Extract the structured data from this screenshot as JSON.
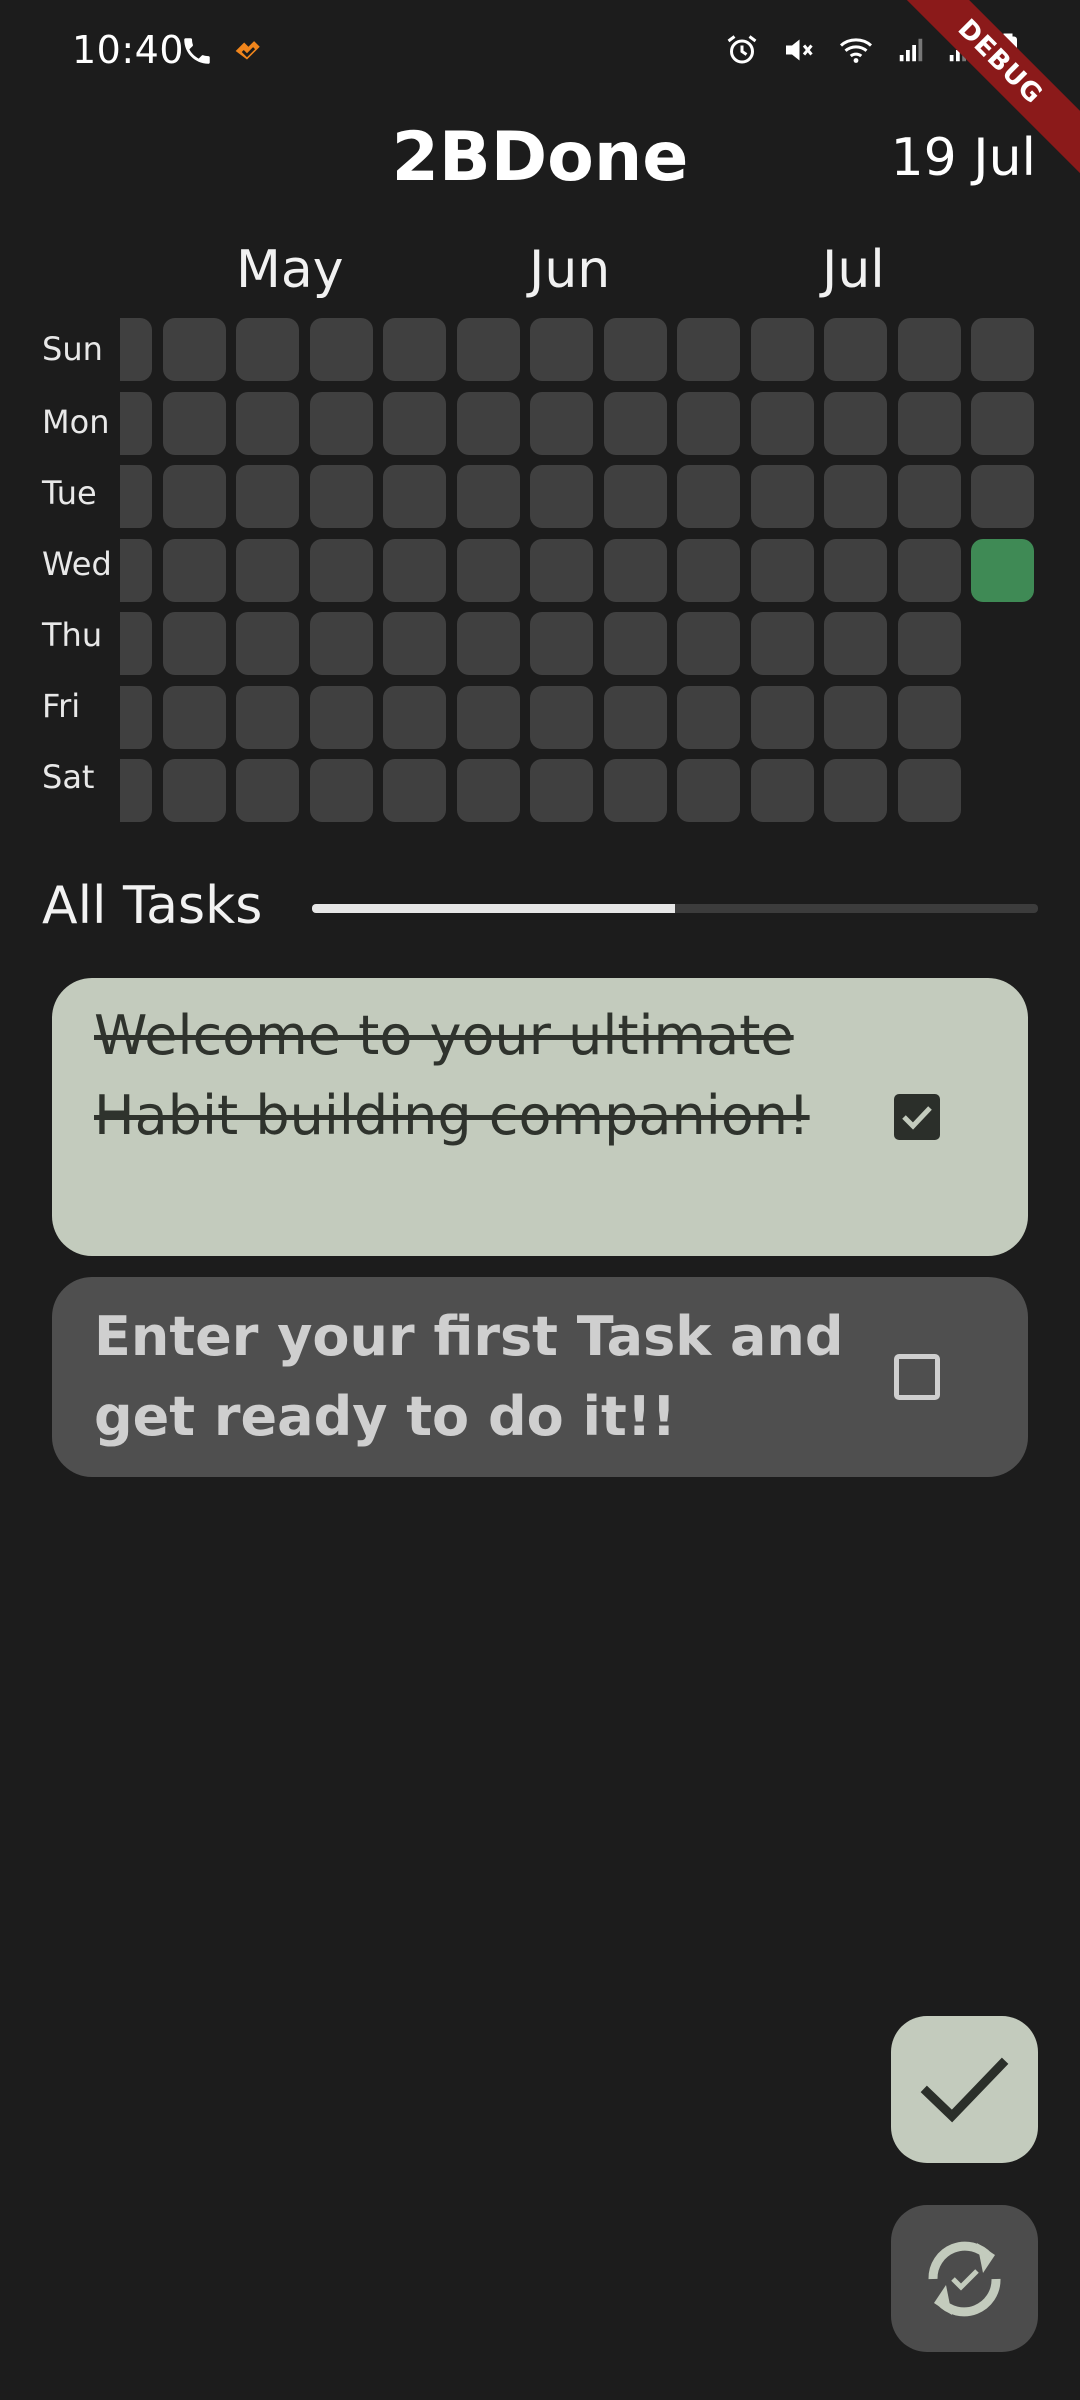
{
  "status_bar": {
    "time": "10:40",
    "left_icons": [
      "phone-icon",
      "app-notification-icon"
    ],
    "right_icons": [
      "alarm-icon",
      "mute-icon",
      "wifi-icon",
      "signal-icon",
      "signal-icon-2",
      "battery-icon"
    ],
    "debug_label": "DEBUG"
  },
  "header": {
    "title": "2BDone",
    "date": "19 Jul"
  },
  "calendar": {
    "months": [
      "May",
      "Jun",
      "Jul"
    ],
    "weekdays": [
      "Sun",
      "Mon",
      "Tue",
      "Wed",
      "Thu",
      "Fri",
      "Sat"
    ],
    "completed_day": "Wed 19 Jul",
    "colors": {
      "empty": "#404040",
      "completed": "#3f8a55"
    }
  },
  "tasks_section": {
    "label": "All Tasks",
    "progress": 0.5
  },
  "tasks": [
    {
      "text": "Welcome to your ultimate Habit building companion!",
      "done": true
    },
    {
      "text": "Enter your first Task and get ready to do it!!",
      "done": false
    }
  ],
  "fabs": {
    "primary": "check-icon",
    "secondary": "sync-icon"
  }
}
